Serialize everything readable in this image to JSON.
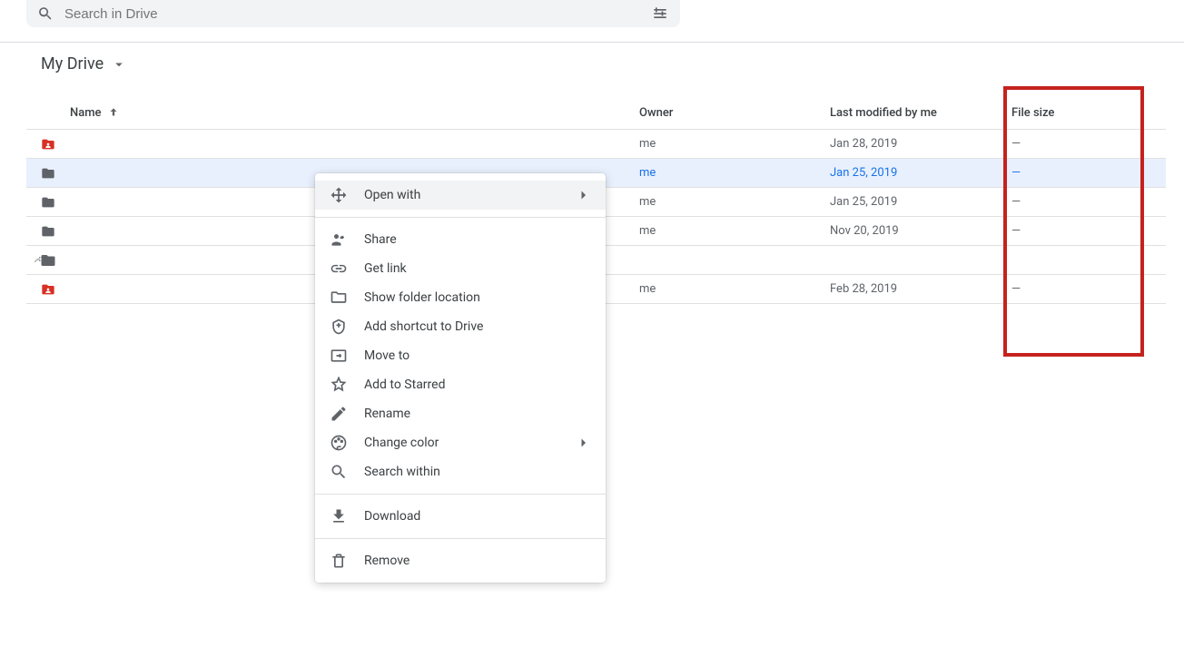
{
  "search": {
    "placeholder": "Search in Drive"
  },
  "breadcrumb": {
    "title": "My Drive"
  },
  "columns": {
    "name": "Name",
    "owner": "Owner",
    "modified": "Last modified by me",
    "size": "File size"
  },
  "rows": [
    {
      "icon": "shared-folder",
      "owner": "me",
      "date": "Jan 28, 2019",
      "size": "—",
      "selected": false
    },
    {
      "icon": "folder",
      "owner": "me",
      "date": "Jan 25, 2019",
      "size": "—",
      "selected": true
    },
    {
      "icon": "folder",
      "owner": "me",
      "date": "Jan 25, 2019",
      "size": "—",
      "selected": false
    },
    {
      "icon": "folder",
      "owner": "me",
      "date": "Nov 20, 2019",
      "size": "—",
      "selected": false
    },
    {
      "icon": "shortcut",
      "owner": "",
      "date": "",
      "size": "",
      "selected": false
    },
    {
      "icon": "shared-folder",
      "owner": "me",
      "date": "Feb 28, 2019",
      "size": "—",
      "selected": false
    }
  ],
  "menu": {
    "open_with": "Open with",
    "share": "Share",
    "get_link": "Get link",
    "show_folder": "Show folder location",
    "add_shortcut": "Add shortcut to Drive",
    "move_to": "Move to",
    "add_starred": "Add to Starred",
    "rename": "Rename",
    "change_color": "Change color",
    "search_within": "Search within",
    "download": "Download",
    "remove": "Remove"
  }
}
